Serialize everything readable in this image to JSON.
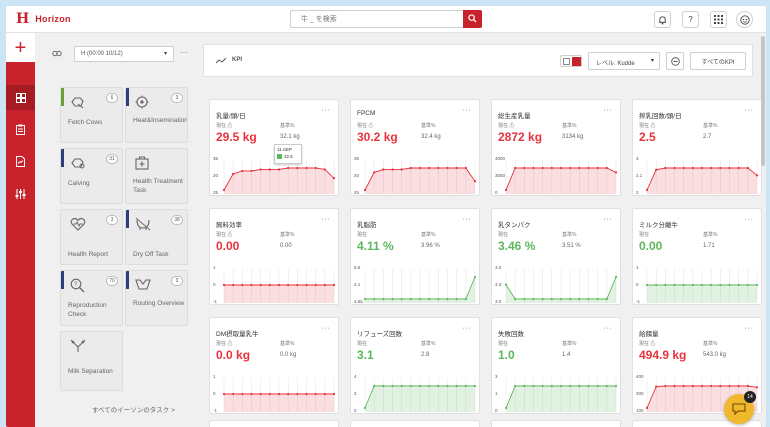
{
  "app": {
    "title": "Horizon"
  },
  "search": {
    "placeholder": "牛 _ を検索"
  },
  "topbar": {
    "help": "?"
  },
  "filter": {
    "selected": "H (00:00 10/12)"
  },
  "tasks": [
    {
      "label": "Fetch Cows",
      "count": "6",
      "color": "#6a9d3c",
      "icon": "fetch-cows-icon"
    },
    {
      "label": "Heat&Insemination",
      "count": "3",
      "color": "#2d3e7a",
      "icon": "heat-insemination-icon"
    },
    {
      "label": "Calving",
      "count": "31",
      "color": "#2d3e7a",
      "icon": "calving-icon"
    },
    {
      "label": "Health Treatment Task",
      "count": "",
      "color": "",
      "icon": "health-treatment-icon"
    },
    {
      "label": "Health Report",
      "count": "3",
      "color": "",
      "icon": "health-report-icon"
    },
    {
      "label": "Dry Off Task",
      "count": "38",
      "color": "#2d3e7a",
      "icon": "dry-off-icon"
    },
    {
      "label": "Reproduction Check",
      "count": "70",
      "color": "#2d3e7a",
      "icon": "reproduction-check-icon"
    },
    {
      "label": "Routing Overview",
      "count": "3",
      "color": "#2d3e7a",
      "icon": "routing-overview-icon"
    },
    {
      "label": "Milk Separation",
      "count": "",
      "color": "",
      "icon": "milk-separation-icon"
    }
  ],
  "tasks_more": "すべてのイーソンのタスク >",
  "kpi": {
    "title": "KPI",
    "level_label": "レベル: Kudde",
    "all_button": "すべてのKPI"
  },
  "cards": [
    {
      "title": "乳量/頭/日",
      "label_left": "現在 ⚠",
      "label_right": "基準%",
      "value": "29.5 kg",
      "ref": "32.1 kg",
      "color": "#e8323c",
      "tick_top": "35",
      "tick_mid": "20",
      "tick_bot": "25",
      "tooltip_date": "11.SEP",
      "tooltip_value": "32.5",
      "series": [
        21,
        26.5,
        27.5,
        27.5,
        28,
        28,
        28,
        28.5,
        28.5,
        28.5,
        28.5,
        28,
        25
      ]
    },
    {
      "title": "FPCM",
      "label_left": "現在 ⚠",
      "label_right": "基準%",
      "value": "30.2 kg",
      "ref": "32.4 kg",
      "color": "#e8323c",
      "tick_top": "35",
      "tick_mid": "20",
      "tick_bot": "25",
      "series": [
        21,
        27,
        28,
        28,
        28,
        28.5,
        28.5,
        28.5,
        28.5,
        28.5,
        28.5,
        28.5,
        24
      ]
    },
    {
      "title": "総生産乳量",
      "label_left": "現在 ⚠",
      "label_right": "基準%",
      "value": "2872 kg",
      "ref": "3134 kg",
      "color": "#e8323c",
      "tick_top": "4000",
      "tick_mid": "3000",
      "tick_bot": "0",
      "series": [
        1000,
        3000,
        3000,
        3000,
        3000,
        3000,
        3000,
        3000,
        3000,
        3000,
        3000,
        3000,
        2600
      ]
    },
    {
      "title": "搾乳回数/頭/日",
      "label_left": "現在 ⚠",
      "label_right": "基準%",
      "value": "2.5",
      "ref": "2.7",
      "color": "#e8323c",
      "tick_top": "3",
      "tick_mid": "2.1",
      "tick_bot": "2",
      "series": [
        2.1,
        2.65,
        2.7,
        2.7,
        2.7,
        2.7,
        2.7,
        2.7,
        2.7,
        2.7,
        2.7,
        2.7,
        2.5
      ]
    },
    {
      "title": "飼料効率",
      "label_left": "現在 ⚠",
      "label_right": "基準%",
      "value": "0.00",
      "ref": "0.00",
      "color": "#e8323c",
      "tick_top": "1",
      "tick_mid": "0",
      "tick_bot": "-1",
      "series": [
        0,
        0,
        0,
        0,
        0,
        0,
        0,
        0,
        0,
        0,
        0,
        0,
        0
      ]
    },
    {
      "title": "乳脂肪",
      "label_left": "現在",
      "label_right": "基準%",
      "value": "4.11 %",
      "ref": "3.96 %",
      "color": "#5cb85c",
      "tick_top": "5.5",
      "tick_mid": "4.1",
      "tick_bot": "3.65",
      "series": [
        3.65,
        3.65,
        3.65,
        3.65,
        3.65,
        3.65,
        3.65,
        3.65,
        3.65,
        3.65,
        3.65,
        3.65,
        4.1
      ]
    },
    {
      "title": "乳タンパク",
      "label_left": "現在",
      "label_right": "基準%",
      "value": "3.46 %",
      "ref": "3.51 %",
      "color": "#5cb85c",
      "tick_top": "3.5",
      "tick_mid": "3.3",
      "tick_bot": "3.0",
      "series": [
        3.3,
        3.0,
        3.0,
        3.0,
        3.0,
        3.0,
        3.0,
        3.0,
        3.0,
        3.0,
        3.0,
        3.0,
        3.46
      ]
    },
    {
      "title": "ミルク分離牛",
      "label_left": "現在",
      "label_right": "基準%",
      "value": "0.00",
      "ref": "1.71",
      "color": "#5cb85c",
      "tick_top": "1",
      "tick_mid": "0",
      "tick_bot": "-1",
      "series": [
        0,
        0,
        0,
        0,
        0,
        0,
        0,
        0,
        0,
        0,
        0,
        0,
        0
      ]
    },
    {
      "title": "DM摂取量乳牛",
      "label_left": "現在 ⚠",
      "label_right": "基準%",
      "value": "0.0 kg",
      "ref": "0.0 kg",
      "color": "#e8323c",
      "tick_top": "1",
      "tick_mid": "0",
      "tick_bot": "-1",
      "series": [
        0,
        0,
        0,
        0,
        0,
        0,
        0,
        0,
        0,
        0,
        0,
        0,
        0
      ]
    },
    {
      "title": "リフューズ回数",
      "label_left": "現在",
      "label_right": "基準%",
      "value": "3.1",
      "ref": "2.8",
      "color": "#5cb85c",
      "tick_top": "4",
      "tick_mid": "2",
      "tick_bot": "0",
      "series": [
        1.5,
        3,
        3,
        3,
        3,
        3,
        3,
        3,
        3,
        3,
        3,
        3,
        3
      ]
    },
    {
      "title": "失敗回数",
      "label_left": "現在",
      "label_right": "基準%",
      "value": "1.0",
      "ref": "1.4",
      "color": "#5cb85c",
      "tick_top": "3",
      "tick_mid": "1",
      "tick_bot": "0",
      "series": [
        0.5,
        1,
        1,
        1,
        1,
        1,
        1,
        1,
        1,
        1,
        1,
        1,
        1
      ]
    },
    {
      "title": "給餌量",
      "label_left": "現在 ⚠",
      "label_right": "基準%",
      "value": "494.9 kg",
      "ref": "543.0 kg",
      "color": "#e8323c",
      "tick_top": "400",
      "tick_mid": "200",
      "tick_bot": "100",
      "series": [
        150,
        480,
        490,
        490,
        490,
        490,
        490,
        490,
        490,
        490,
        490,
        490,
        470
      ]
    }
  ],
  "chat": {
    "badge": "14"
  }
}
